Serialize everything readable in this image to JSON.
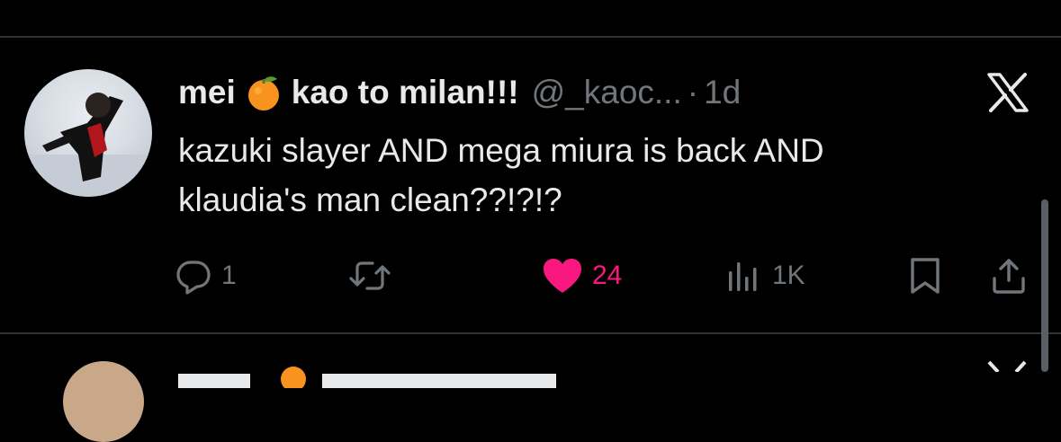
{
  "tweet": {
    "display_name_part1": "mei",
    "display_name_part2": "kao to milan!!!",
    "name_emoji": "tangerine-emoji",
    "handle": "@_kaoc...",
    "separator": "·",
    "time": "1d",
    "text_line1": "kazuki slayer AND mega miura is back AND",
    "text_line2": "klaudia's man clean??!?!?",
    "replies": "1",
    "likes": "24",
    "views": "1K"
  },
  "colors": {
    "background": "#000000",
    "primary_text": "#e7e9ea",
    "secondary_text": "#71767b",
    "like_pink": "#f91880",
    "divider": "#2f3336"
  },
  "icons": [
    "reply-icon",
    "retweet-icon",
    "heart-icon",
    "views-icon",
    "bookmark-icon",
    "share-icon",
    "x-logo-icon"
  ]
}
